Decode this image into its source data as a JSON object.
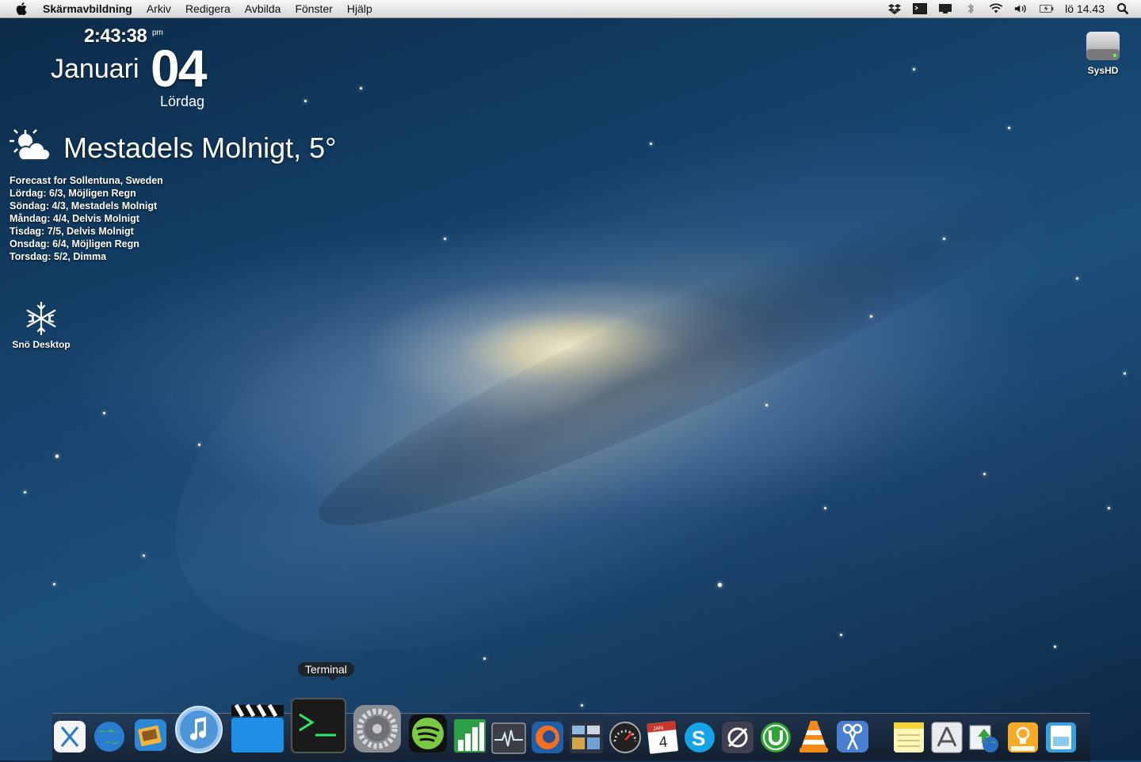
{
  "menubar": {
    "app_name": "Skärmavbildning",
    "items": [
      "Arkiv",
      "Redigera",
      "Avbilda",
      "Fönster",
      "Hjälp"
    ],
    "clock": "lö 14.43",
    "icons": [
      "dropbox-icon",
      "terminal-status-icon",
      "display-icon",
      "bluetooth-icon",
      "wifi-icon",
      "volume-icon",
      "battery-icon",
      "spotlight-icon"
    ]
  },
  "clock_widget": {
    "time": "2:43:38",
    "ampm": "pm",
    "month": "Januari",
    "day": "04",
    "weekday": "Lördag"
  },
  "weather": {
    "current": "Mestadels Molnigt, 5°",
    "forecast": [
      "Forecast for Sollentuna, Sweden",
      "Lördag: 6/3, Möjligen Regn",
      "Söndag: 4/3, Mestadels Molnigt",
      "Måndag: 4/4, Delvis Molnigt",
      "Tisdag: 7/5, Delvis Molnigt",
      "Onsdag: 6/4, Möjligen Regn",
      "Torsdag: 5/2, Dimma"
    ]
  },
  "desktop": {
    "drive_label": "SysHD",
    "snow_label": "Snö Desktop"
  },
  "dock": {
    "tooltip": "Terminal",
    "calendar_month": "JAN",
    "calendar_day": "4",
    "items": [
      "xquartz",
      "globe",
      "photo-browser",
      "itunes",
      "final-cut",
      "terminal",
      "system-preferences",
      "spotify",
      "numbers",
      "activity-monitor",
      "firefox",
      "mission-control",
      "dashboard",
      "calendar",
      "skype",
      "vpn",
      "utorrent",
      "vlc",
      "scissors",
      "notes",
      "app-store",
      "network-globe",
      "bulb",
      "preview"
    ]
  }
}
